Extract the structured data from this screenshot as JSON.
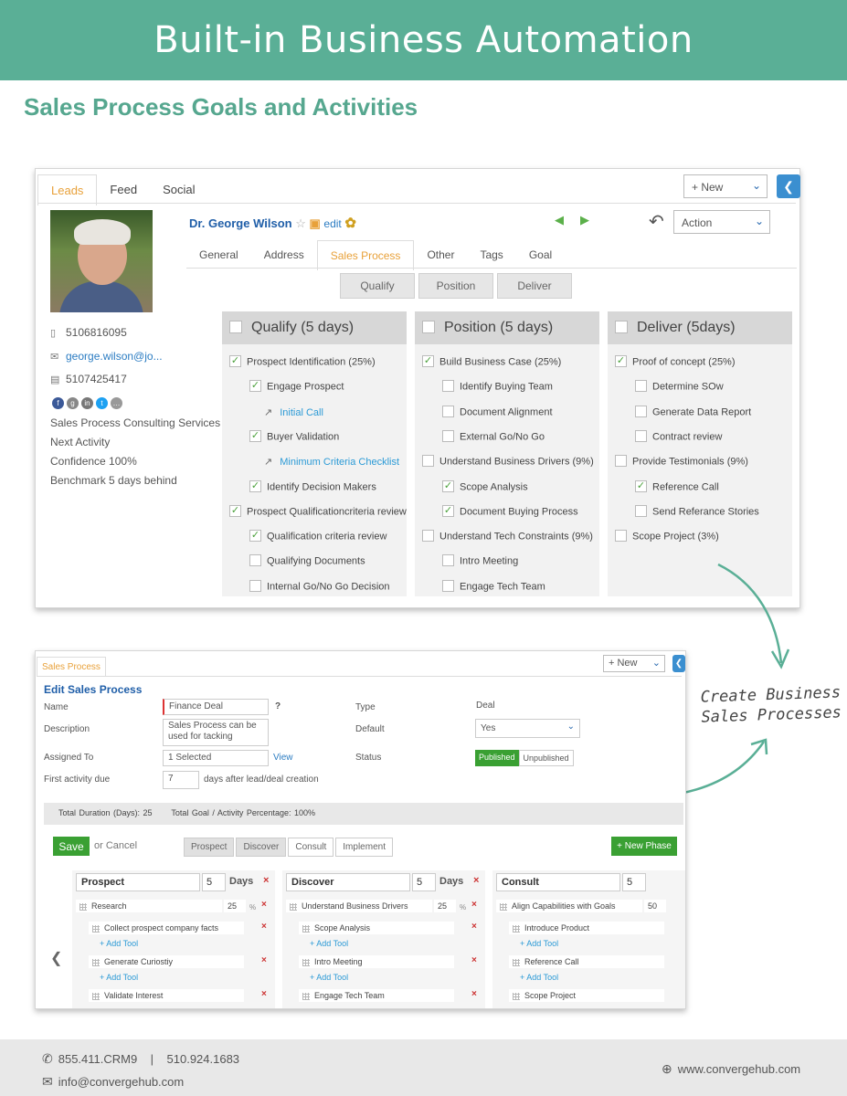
{
  "header": {
    "title": "Built-in Business Automation",
    "subtitle": "Sales Process Goals and Activities"
  },
  "lead_view": {
    "tabs": [
      "Leads",
      "Feed",
      "Social"
    ],
    "new_button": "+ New",
    "name": "Dr. George Wilson",
    "edit_link": "edit",
    "action_select": "Action",
    "sub_tabs": [
      "General",
      "Address",
      "Sales Process",
      "Other",
      "Tags",
      "Goal"
    ],
    "phase_buttons": [
      "Qualify",
      "Position",
      "Deliver"
    ],
    "contact": {
      "phone": "5106816095",
      "email": "george.wilson@jo...",
      "fax": "5107425417",
      "company": "Sales Process Consulting Services",
      "next_activity": "Next Activity",
      "confidence": "Confidence 100%",
      "benchmark": "Benchmark 5 days behind"
    },
    "columns": [
      {
        "title": "Qualify (5 days)",
        "items": [
          {
            "text": "Prospect Identification (25%)",
            "checked": true,
            "level": 0
          },
          {
            "text": "Engage Prospect",
            "checked": true,
            "level": 1
          },
          {
            "text": "Initial Call",
            "link": true,
            "level": 2
          },
          {
            "text": "Buyer Validation",
            "checked": true,
            "level": 1
          },
          {
            "text": "Minimum Criteria Checklist",
            "link": true,
            "level": 2
          },
          {
            "text": "Identify Decision Makers",
            "checked": true,
            "level": 1
          },
          {
            "text": "Prospect Qualificationcriteria review",
            "checked": true,
            "level": 0
          },
          {
            "text": "Qualification criteria review",
            "checked": true,
            "level": 1
          },
          {
            "text": "Qualifying Documents",
            "checked": false,
            "level": 1
          },
          {
            "text": "Internal Go/No Go Decision",
            "checked": false,
            "level": 1
          }
        ]
      },
      {
        "title": "Position (5 days)",
        "items": [
          {
            "text": "Build Business Case (25%)",
            "checked": true,
            "level": 0
          },
          {
            "text": "Identify Buying Team",
            "checked": false,
            "level": 1
          },
          {
            "text": "Document Alignment",
            "checked": false,
            "level": 1
          },
          {
            "text": "External Go/No Go",
            "checked": false,
            "level": 1
          },
          {
            "text": "Understand Business Drivers (9%)",
            "checked": false,
            "level": 0
          },
          {
            "text": "Scope Analysis",
            "checked": true,
            "level": 1
          },
          {
            "text": "Document Buying Process",
            "checked": true,
            "level": 1
          },
          {
            "text": "Understand Tech Constraints (9%)",
            "checked": false,
            "level": 0
          },
          {
            "text": "Intro Meeting",
            "checked": false,
            "level": 1
          },
          {
            "text": "Engage Tech Team",
            "checked": false,
            "level": 1
          }
        ]
      },
      {
        "title": "Deliver (5days)",
        "items": [
          {
            "text": "Proof of concept (25%)",
            "checked": true,
            "level": 0
          },
          {
            "text": "Determine SOw",
            "checked": false,
            "level": 1
          },
          {
            "text": "Generate Data Report",
            "checked": false,
            "level": 1
          },
          {
            "text": "Contract review",
            "checked": false,
            "level": 1
          },
          {
            "text": "Provide Testimonials (9%)",
            "checked": false,
            "level": 0
          },
          {
            "text": "Reference Call",
            "checked": true,
            "level": 1
          },
          {
            "text": "Send Referance Stories",
            "checked": false,
            "level": 1
          },
          {
            "text": "Scope Project (3%)",
            "checked": false,
            "level": 0
          }
        ]
      }
    ]
  },
  "callout": {
    "line1": "Create Business",
    "line2": "Sales Processes"
  },
  "edit_view": {
    "tab": "Sales Process",
    "new_button": "+ New",
    "title": "Edit Sales Process",
    "labels": {
      "name": "Name",
      "description": "Description",
      "assigned_to": "Assigned To",
      "first_activity_due": "First activity due",
      "type": "Type",
      "default": "Default",
      "status": "Status"
    },
    "name_value": "Finance Deal",
    "help": "?",
    "description_value": "Sales Process can be used for tacking",
    "assigned_value": "1 Selected",
    "view_link": "View",
    "first_activity_value": "7",
    "days_after": "days after lead/deal creation",
    "type_value": "Deal",
    "default_value": "Yes",
    "status_on": "Published",
    "status_off": "Unpublished",
    "total_duration": "Total Duration (Days): 25",
    "total_goal": "Total Goal / Activity Percentage: 100%",
    "save": "Save",
    "or_cancel": "or  Cancel",
    "phase_tabs": [
      "Prospect",
      "Discover",
      "Consult",
      "Implement"
    ],
    "new_phase": "+ New Phase",
    "add_tool": "+ Add Tool",
    "days_label": "Days",
    "pct": "%",
    "phases": [
      {
        "name": "Prospect",
        "days": "5",
        "goal": "Research",
        "goal_pct": "25",
        "activities": [
          "Collect prospect company facts",
          "Generate Curiostiy",
          "Validate Interest"
        ]
      },
      {
        "name": "Discover",
        "days": "5",
        "goal": "Understand Business Drivers",
        "goal_pct": "25",
        "activities": [
          "Scope Analysis",
          "Intro Meeting",
          "Engage Tech Team"
        ]
      },
      {
        "name": "Consult",
        "days": "5",
        "goal": "Align Capabilities with Goals",
        "goal_pct": "50",
        "activities": [
          "Introduce Product",
          "Reference Call",
          "Scope Project"
        ]
      }
    ]
  },
  "footer": {
    "phone1": "855.411.CRM9",
    "sep": "|",
    "phone2": "510.924.1683",
    "email": "info@convergehub.com",
    "website": "www.convergehub.com"
  },
  "colors": {
    "brand_green": "#5aaf96",
    "accent_orange": "#e8a13a",
    "link_blue": "#1f5ea8",
    "published_green": "#3aa033"
  }
}
